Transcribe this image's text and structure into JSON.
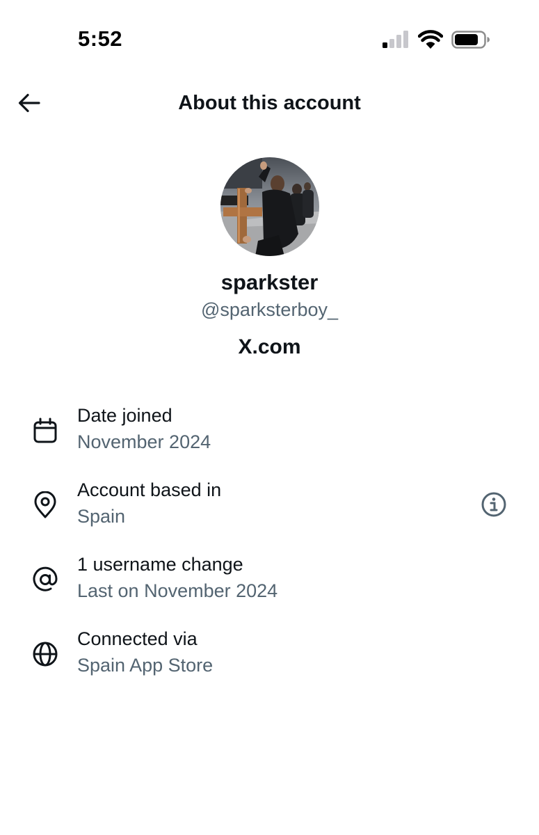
{
  "status_bar": {
    "time": "5:52",
    "signal_icon": "cellular-signal-icon",
    "wifi_icon": "wifi-icon",
    "battery_icon": "battery-icon"
  },
  "header": {
    "back_icon": "arrow-left-icon",
    "title": "About this account"
  },
  "profile": {
    "display_name": "sparkster",
    "handle": "@sparksterboy_",
    "domain": "X.com"
  },
  "details": [
    {
      "icon": "calendar-icon",
      "label": "Date joined",
      "value": "November 2024"
    },
    {
      "icon": "location-pin-icon",
      "label": "Account based in",
      "value": "Spain",
      "action_icon": "info-icon"
    },
    {
      "icon": "at-sign-icon",
      "label": "1 username change",
      "value": "Last on November 2024"
    },
    {
      "icon": "globe-icon",
      "label": "Connected via",
      "value": "Spain App Store"
    }
  ],
  "colors": {
    "primary_text": "#0f1419",
    "secondary_text": "#536471",
    "background": "#ffffff"
  }
}
